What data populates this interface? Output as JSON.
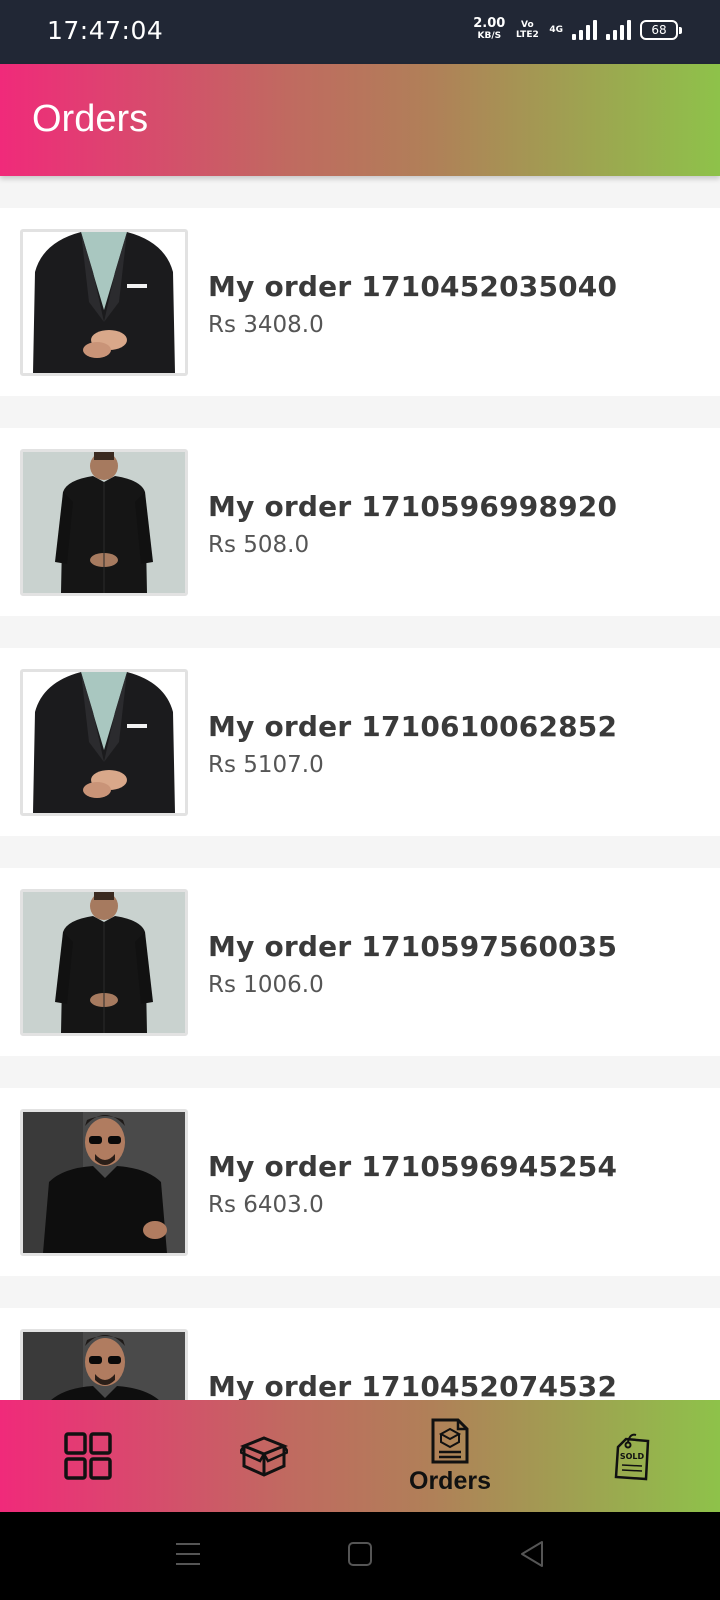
{
  "status_bar": {
    "time": "17:47:04",
    "net_speed": "2.00",
    "net_unit": "KB/S",
    "volte": "Vo LTE2",
    "network": "4G",
    "battery": "68"
  },
  "app_bar": {
    "title": "Orders"
  },
  "orders": [
    {
      "name": "My order 1710452035040",
      "price": "Rs 3408.0",
      "image": "blazer"
    },
    {
      "name": "My order 1710596998920",
      "price": "Rs 508.0",
      "image": "black-kurta"
    },
    {
      "name": "My order 1710610062852",
      "price": "Rs 5107.0",
      "image": "blazer"
    },
    {
      "name": "My order 1710597560035",
      "price": "Rs 1006.0",
      "image": "black-kurta"
    },
    {
      "name": "My order 1710596945254",
      "price": "Rs 6403.0",
      "image": "black-shirt"
    },
    {
      "name": "My order 1710452074532",
      "price": "",
      "image": "black-shirt"
    }
  ],
  "bottom_nav": {
    "items": [
      {
        "icon": "dashboard-grid-icon",
        "label": ""
      },
      {
        "icon": "box-icon",
        "label": ""
      },
      {
        "icon": "orders-document-icon",
        "label": "Orders"
      },
      {
        "icon": "sold-tag-icon",
        "label": ""
      }
    ],
    "active_index": 2
  },
  "colors": {
    "gradient_start": "#f02a7a",
    "gradient_end": "#8ec24a",
    "status_bar": "#212735"
  }
}
